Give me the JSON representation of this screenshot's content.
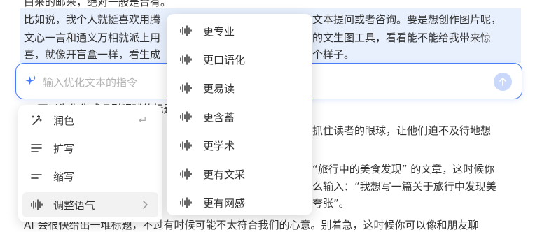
{
  "document": {
    "top_line": "白来的邮来，绝对一般是合有。",
    "selected_lines": [
      "比如说，我个人就挺喜欢用腾",
      "文心一言和通义万相就派上用",
      "喜，就像开盲盒一样，看生成"
    ],
    "selected_right": [
      "文本提问或者咨询。要是想创作图片呢，",
      "的文生图工具，看看能不能给我带来惊",
      "个样子。"
    ],
    "body_lines": [
      {
        "left": "AI 可以为你生成吸引眼球的标题",
        "right": ""
      },
      {
        "left": "",
        "right": "抓住读者的眼球，让他们迫不及待地想"
      },
      {
        "left": "",
        "right": ""
      },
      {
        "left": "",
        "right": "“旅行中的美食发现” 的文章，这时候你"
      },
      {
        "left": "",
        "right": "么输入：“我想写一篇关于旅行中发现美"
      },
      {
        "left": "",
        "right": "夸张”。"
      },
      {
        "left": "AI 会很快给出一堆标题，不过有时候可能不太符合我们的心意。别着急，这时候你可以像和朋友聊",
        "right": ""
      }
    ]
  },
  "ai_input": {
    "placeholder": "输入优化文本的指令"
  },
  "left_menu": {
    "items": [
      {
        "label": "润色",
        "icon": "magic-wand-icon",
        "shortcut": "↵"
      },
      {
        "label": "扩写",
        "icon": "expand-lines-icon"
      },
      {
        "label": "缩写",
        "icon": "shrink-lines-icon"
      },
      {
        "label": "调整语气",
        "icon": "waveform-icon"
      }
    ]
  },
  "tone_menu": {
    "items": [
      {
        "label": "更专业"
      },
      {
        "label": "更口语化"
      },
      {
        "label": "更易读"
      },
      {
        "label": "更含蓄"
      },
      {
        "label": "更学术"
      },
      {
        "label": "更有文采"
      },
      {
        "label": "更有网感"
      }
    ]
  },
  "colors": {
    "accent": "#4a7cf7",
    "selection": "#e8f0fe",
    "send_disabled": "#c9d8fb"
  }
}
